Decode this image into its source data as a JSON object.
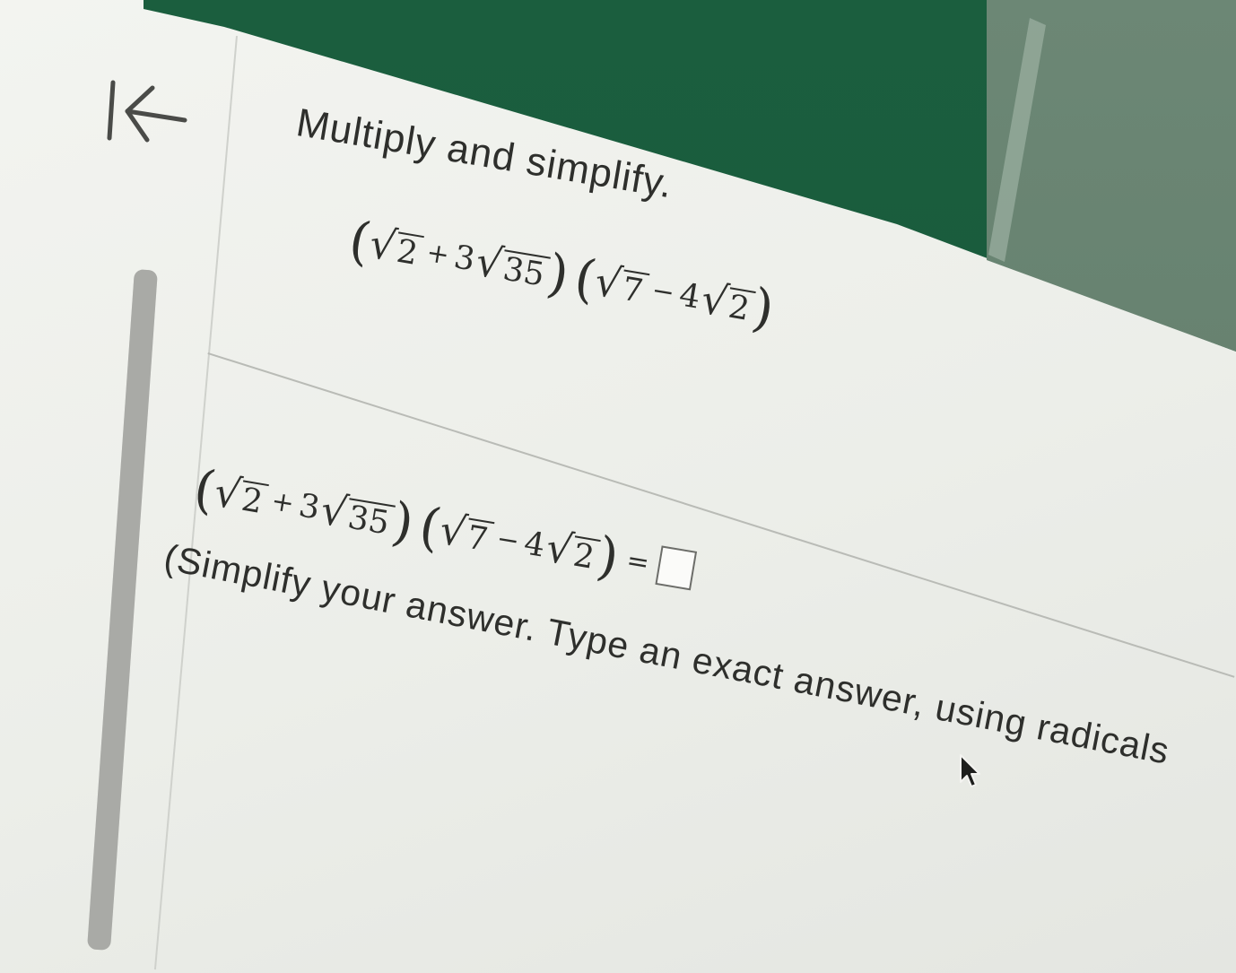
{
  "nav": {
    "back_icon": "back-to-start-icon"
  },
  "question": {
    "prompt": "Multiply and simplify.",
    "expression": {
      "term1_radicand": "2",
      "plus": "+",
      "term2_coef": "3",
      "term2_radicand": "35",
      "term3_radicand": "7",
      "minus": "−",
      "term4_coef": "4",
      "term4_radicand": "2"
    }
  },
  "answer": {
    "equals": "=",
    "value": "",
    "instructions": "(Simplify your answer. Type an exact answer, using radicals"
  },
  "colors": {
    "header_green": "#1b5e3e",
    "text": "#2e2f2c",
    "background": "#eceee9"
  }
}
